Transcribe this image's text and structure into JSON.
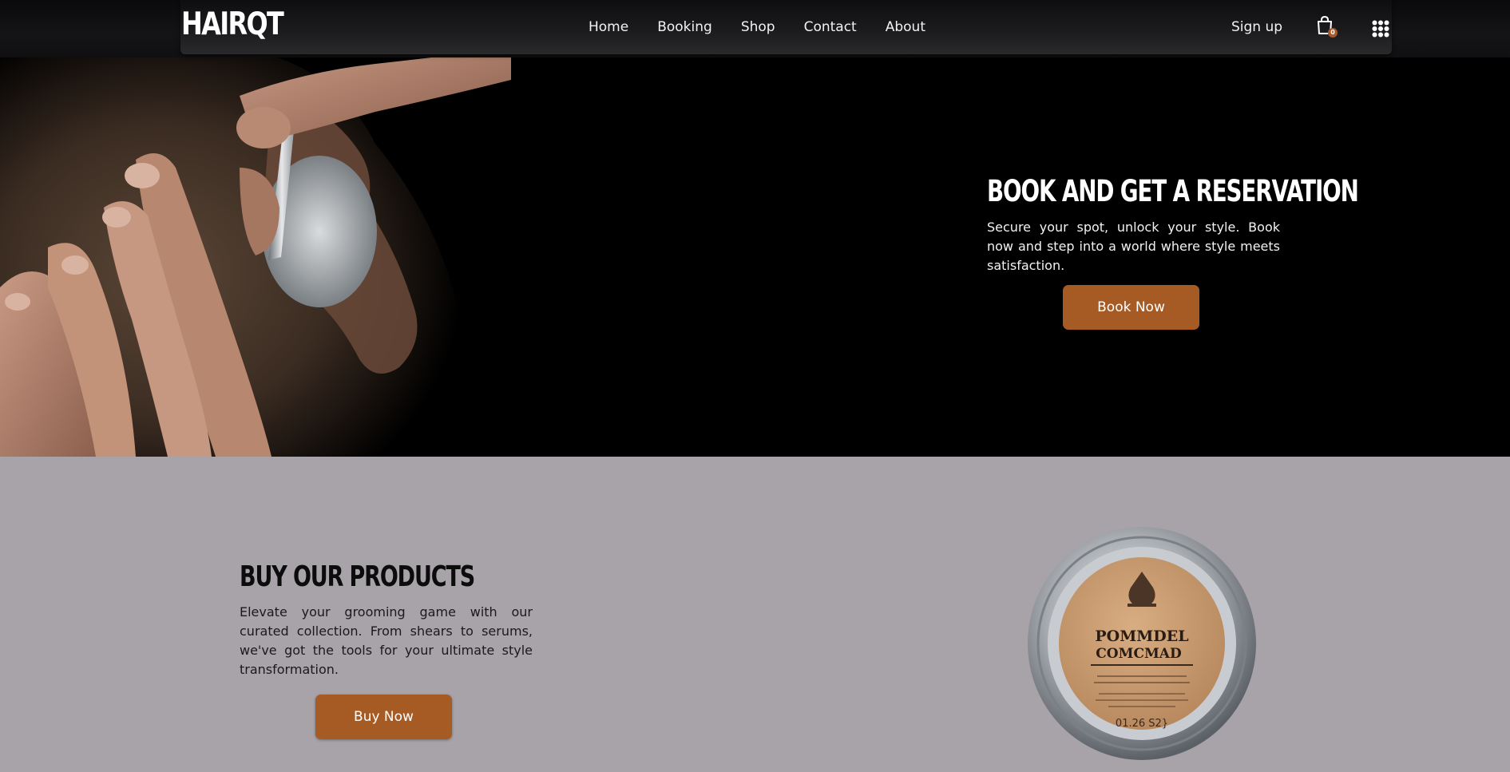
{
  "brand": {
    "logo": "HAIRQT"
  },
  "nav": {
    "links": [
      "Home",
      "Booking",
      "Shop",
      "Contact",
      "About"
    ],
    "signup": "Sign up",
    "cart_count": "0"
  },
  "hero": {
    "title": "BOOK AND GET A RESERVATION",
    "description": "Secure your spot, unlock your style. Book now and step into a world where style meets satisfaction.",
    "button": "Book Now"
  },
  "products": {
    "title": "BUY OUR PRODUCTS",
    "description": "Elevate your grooming game with our curated collection. From shears to serums, we've got the tools for your ultimate style transformation.",
    "button": "Buy Now",
    "product_label_line1": "POMMDEL",
    "product_label_line2": "COMCMAD",
    "product_weight": "01.26 S2}"
  },
  "colors": {
    "accent": "#a65b25",
    "hero_bg": "#000000",
    "products_bg": "#a7a3a9"
  }
}
